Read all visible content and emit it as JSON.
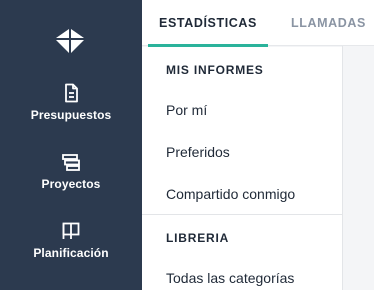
{
  "colors": {
    "sidebar_bg": "#2c3a4f",
    "accent": "#2ab39b",
    "text": "#1f2937",
    "muted_tab": "#8a94a3"
  },
  "sidebar": {
    "logo_icon": "logo-icon",
    "items": [
      {
        "label": "Presupuestos",
        "icon": "document-icon"
      },
      {
        "label": "Proyectos",
        "icon": "stack-icon"
      },
      {
        "label": "Planificación",
        "icon": "board-icon"
      }
    ]
  },
  "tabs": [
    {
      "label": "ESTADÍSTICAS",
      "active": true
    },
    {
      "label": "LLAMADAS",
      "active": false
    }
  ],
  "menu": {
    "sections": [
      {
        "header": "MIS INFORMES",
        "items": [
          "Por mí",
          "Preferidos",
          "Compartido conmigo"
        ]
      },
      {
        "header": "LIBRERIA",
        "items": [
          "Todas las categorías"
        ]
      }
    ]
  }
}
